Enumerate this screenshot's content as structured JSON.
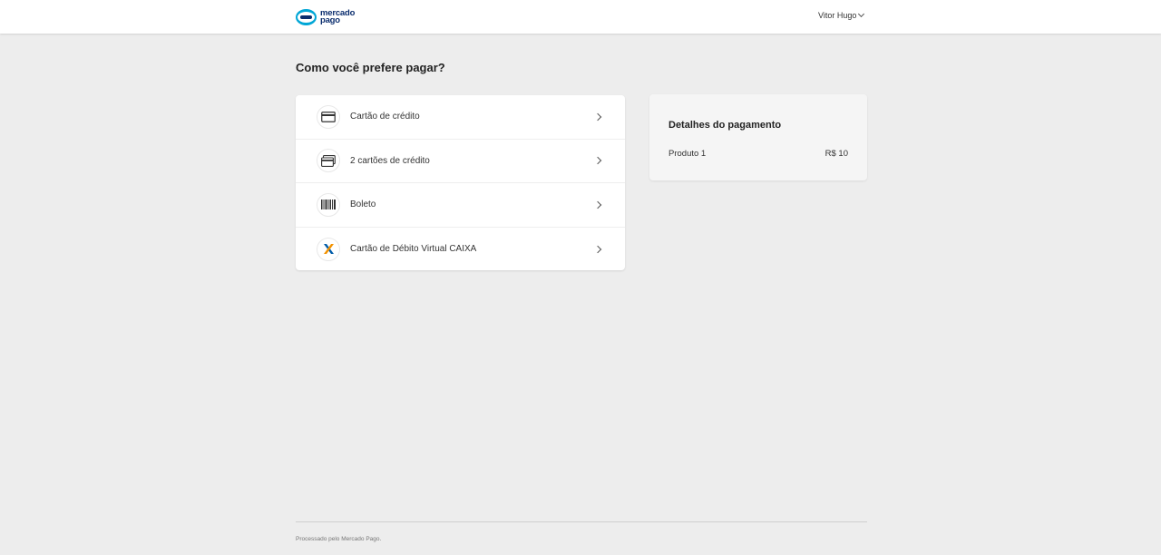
{
  "header": {
    "logo_line1": "mercado",
    "logo_line2": "pago",
    "user_name": "Vitor Hugo"
  },
  "page": {
    "title": "Como você prefere pagar?"
  },
  "payment_methods": [
    {
      "label": "Cartão de crédito",
      "icon": "credit-card-icon"
    },
    {
      "label": "2 cartões de crédito",
      "icon": "two-cards-icon"
    },
    {
      "label": "Boleto",
      "icon": "barcode-icon"
    },
    {
      "label": "Cartão de Débito Virtual CAIXA",
      "icon": "caixa-logo-icon"
    }
  ],
  "summary": {
    "title": "Detalhes do pagamento",
    "item_name": "Produto 1",
    "item_price": "R$ 10"
  },
  "footer": {
    "text": "Processado pelo Mercado Pago."
  },
  "colors": {
    "background": "#ededed",
    "brand_dark": "#0a2d6e",
    "brand_light": "#00a6d6",
    "caixa_orange": "#f39200",
    "caixa_blue": "#005ca9"
  }
}
